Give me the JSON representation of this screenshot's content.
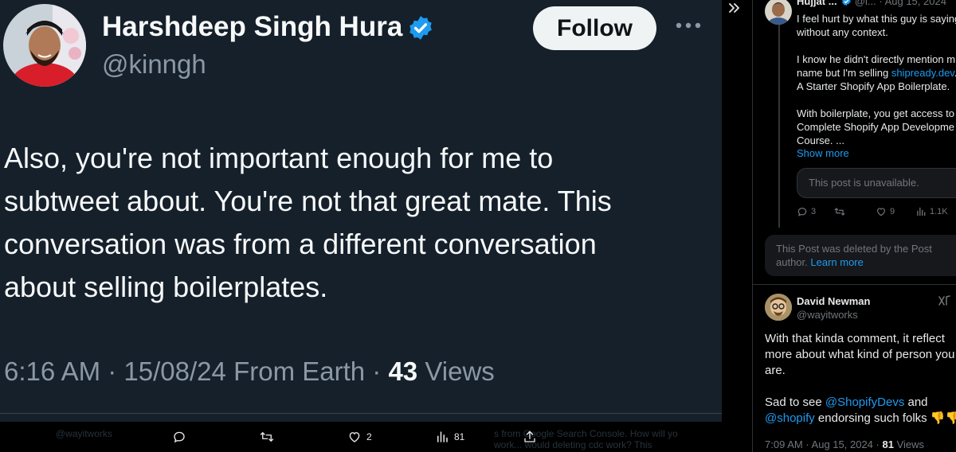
{
  "main_tweet": {
    "display_name": "Harshdeep Singh Hura",
    "handle": "@kinngh",
    "follow_label": "Follow",
    "text": "Also, you're not important enough for me to subtweet about. You're not that great mate. This conversation was from a different conversation about selling boilerplates.",
    "lines": [
      "Also, you're not important enough for me to",
      "subtweet about. You're not that great mate. This",
      "conversation was from a different conversation",
      "about selling boilerplates."
    ],
    "time": "6:16 AM",
    "date": "15/08/24",
    "source": "From Earth",
    "separator": "·",
    "views_count": "43",
    "views_label": "Views",
    "colors": {
      "background": "#15202b",
      "verified": "#1d9bf0",
      "follow_bg": "#eff3f4"
    }
  },
  "bottom_bar": {
    "ghost_texts": [
      "@wayitworks",
      "s from Google Search Console. How will yo",
      "work... would deleting cdc work? This"
    ],
    "actions": [
      {
        "icon": "reply-icon",
        "count": ""
      },
      {
        "icon": "retweet-icon",
        "count": ""
      },
      {
        "icon": "like-icon",
        "count": "2"
      },
      {
        "icon": "views-icon",
        "count": "81"
      },
      {
        "icon": "share-icon",
        "count": ""
      }
    ]
  },
  "right_column": {
    "hujjat": {
      "name": "Hujjat ...",
      "handle_trunc": "@i...",
      "date": "· Aug 15, 2024",
      "lines": [
        {
          "type": "text",
          "value": "I feel hurt by what this guy is saying"
        },
        {
          "type": "text",
          "value": "without any context."
        },
        {
          "type": "text",
          "value": "I know he didn't directly mention m"
        },
        {
          "type": "mixed",
          "before": "name but I'm selling ",
          "link": "shipready.dev",
          "after": "."
        },
        {
          "type": "text",
          "value": "A Starter Shopify App Boilerplate."
        },
        {
          "type": "text",
          "value": "With boilerplate, you get access to"
        },
        {
          "type": "text",
          "value": "Complete Shopify App Developme"
        },
        {
          "type": "text",
          "value": "Course. ..."
        }
      ],
      "show_more": "Show more",
      "unavailable": "This post is unavailable.",
      "actions": [
        {
          "icon": "reply-icon",
          "count": "3"
        },
        {
          "icon": "retweet-icon",
          "count": ""
        },
        {
          "icon": "like-icon",
          "count": "9"
        },
        {
          "icon": "views-icon",
          "count": "1.1K"
        }
      ]
    },
    "deleted_notice": {
      "line1": "This Post was deleted by the Post",
      "line2": "author.",
      "learn_more": "Learn more"
    },
    "david": {
      "name": "David Newman",
      "handle": "@wayitworks",
      "lines": [
        "With that kinda comment, it reflect",
        "more about what kind of person you",
        "are."
      ],
      "sad_prefix": "Sad to see ",
      "mention1": "@ShopifyDevs",
      "sad_suffix": " and",
      "mention2": "@shopify",
      "endorse": " endorsing such folks",
      "emoji": "👎👎",
      "time": "7:09 AM",
      "date": "· Aug 15, 2024 ·",
      "views_count": "81",
      "views_label": "Views"
    }
  }
}
